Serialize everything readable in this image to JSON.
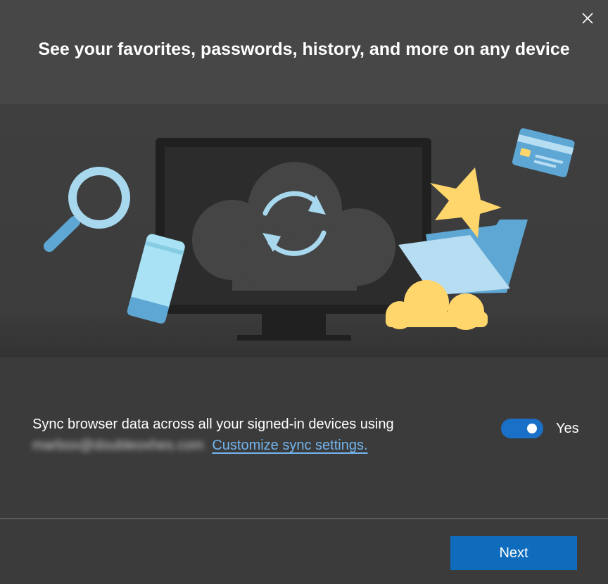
{
  "dialog": {
    "title": "See your favorites, passwords, history, and more on any device",
    "close_icon": "close-icon"
  },
  "hero": {
    "icons": [
      "magnifier-icon",
      "phone-icon",
      "monitor-icon",
      "cloud-sync-icon",
      "star-icon",
      "folder-icon",
      "credit-card-icon",
      "cloud-icon"
    ],
    "colors": {
      "light_blue": "#a8d8ee",
      "mid_blue": "#5ea6d3",
      "yellow": "#ffd66b",
      "monitor": "#202020",
      "screen": "#2c2c2c",
      "cloud": "#454545"
    }
  },
  "sync": {
    "description": "Sync browser data across all your signed-in devices using",
    "email": "marbox@doubleoxhes.com",
    "link_text": "Customize sync settings.",
    "toggle_on": true,
    "toggle_label": "Yes"
  },
  "footer": {
    "next_label": "Next"
  },
  "colors": {
    "accent": "#0f6cbd",
    "link": "#73b4ee",
    "background": "#3b3b3b",
    "header": "#474747"
  }
}
